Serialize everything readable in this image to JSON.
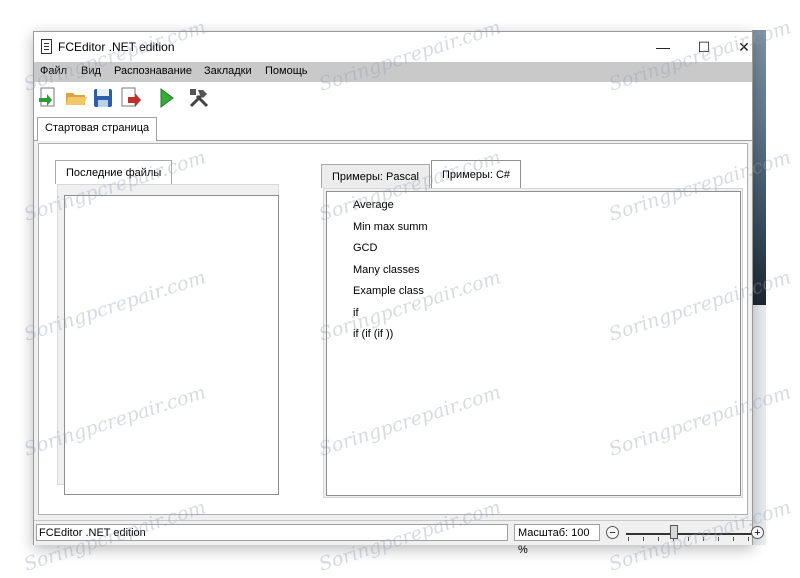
{
  "window": {
    "title": "FCEditor .NET edition"
  },
  "controls": {
    "minimize": "—",
    "maximize": "☐",
    "close": "✕"
  },
  "menu": [
    "Файл",
    "Вид",
    "Распознавание",
    "Закладки",
    "Помощь"
  ],
  "toolbar": [
    "new-file-icon",
    "open-folder-icon",
    "save-icon",
    "export-icon",
    "run-icon",
    "tools-icon"
  ],
  "tabs": {
    "start": "Стартовая страница"
  },
  "recent": {
    "tab_label": "Последние файлы"
  },
  "examples": {
    "tabs": [
      "Примеры: Pascal",
      "Примеры: C#"
    ],
    "selected_tab": "Примеры: C#",
    "items": [
      "Average",
      "Min max summ",
      "GCD",
      "Many classes",
      "Example class",
      "if",
      "if (if (if ))"
    ]
  },
  "status": {
    "text": "FCEditor .NET edition",
    "zoom_label": "Масштаб: 100 %",
    "zoom_minus": "−",
    "zoom_plus": "+",
    "zoom_percent": 100
  },
  "watermark": {
    "text": "Soringpcrepair.com"
  }
}
